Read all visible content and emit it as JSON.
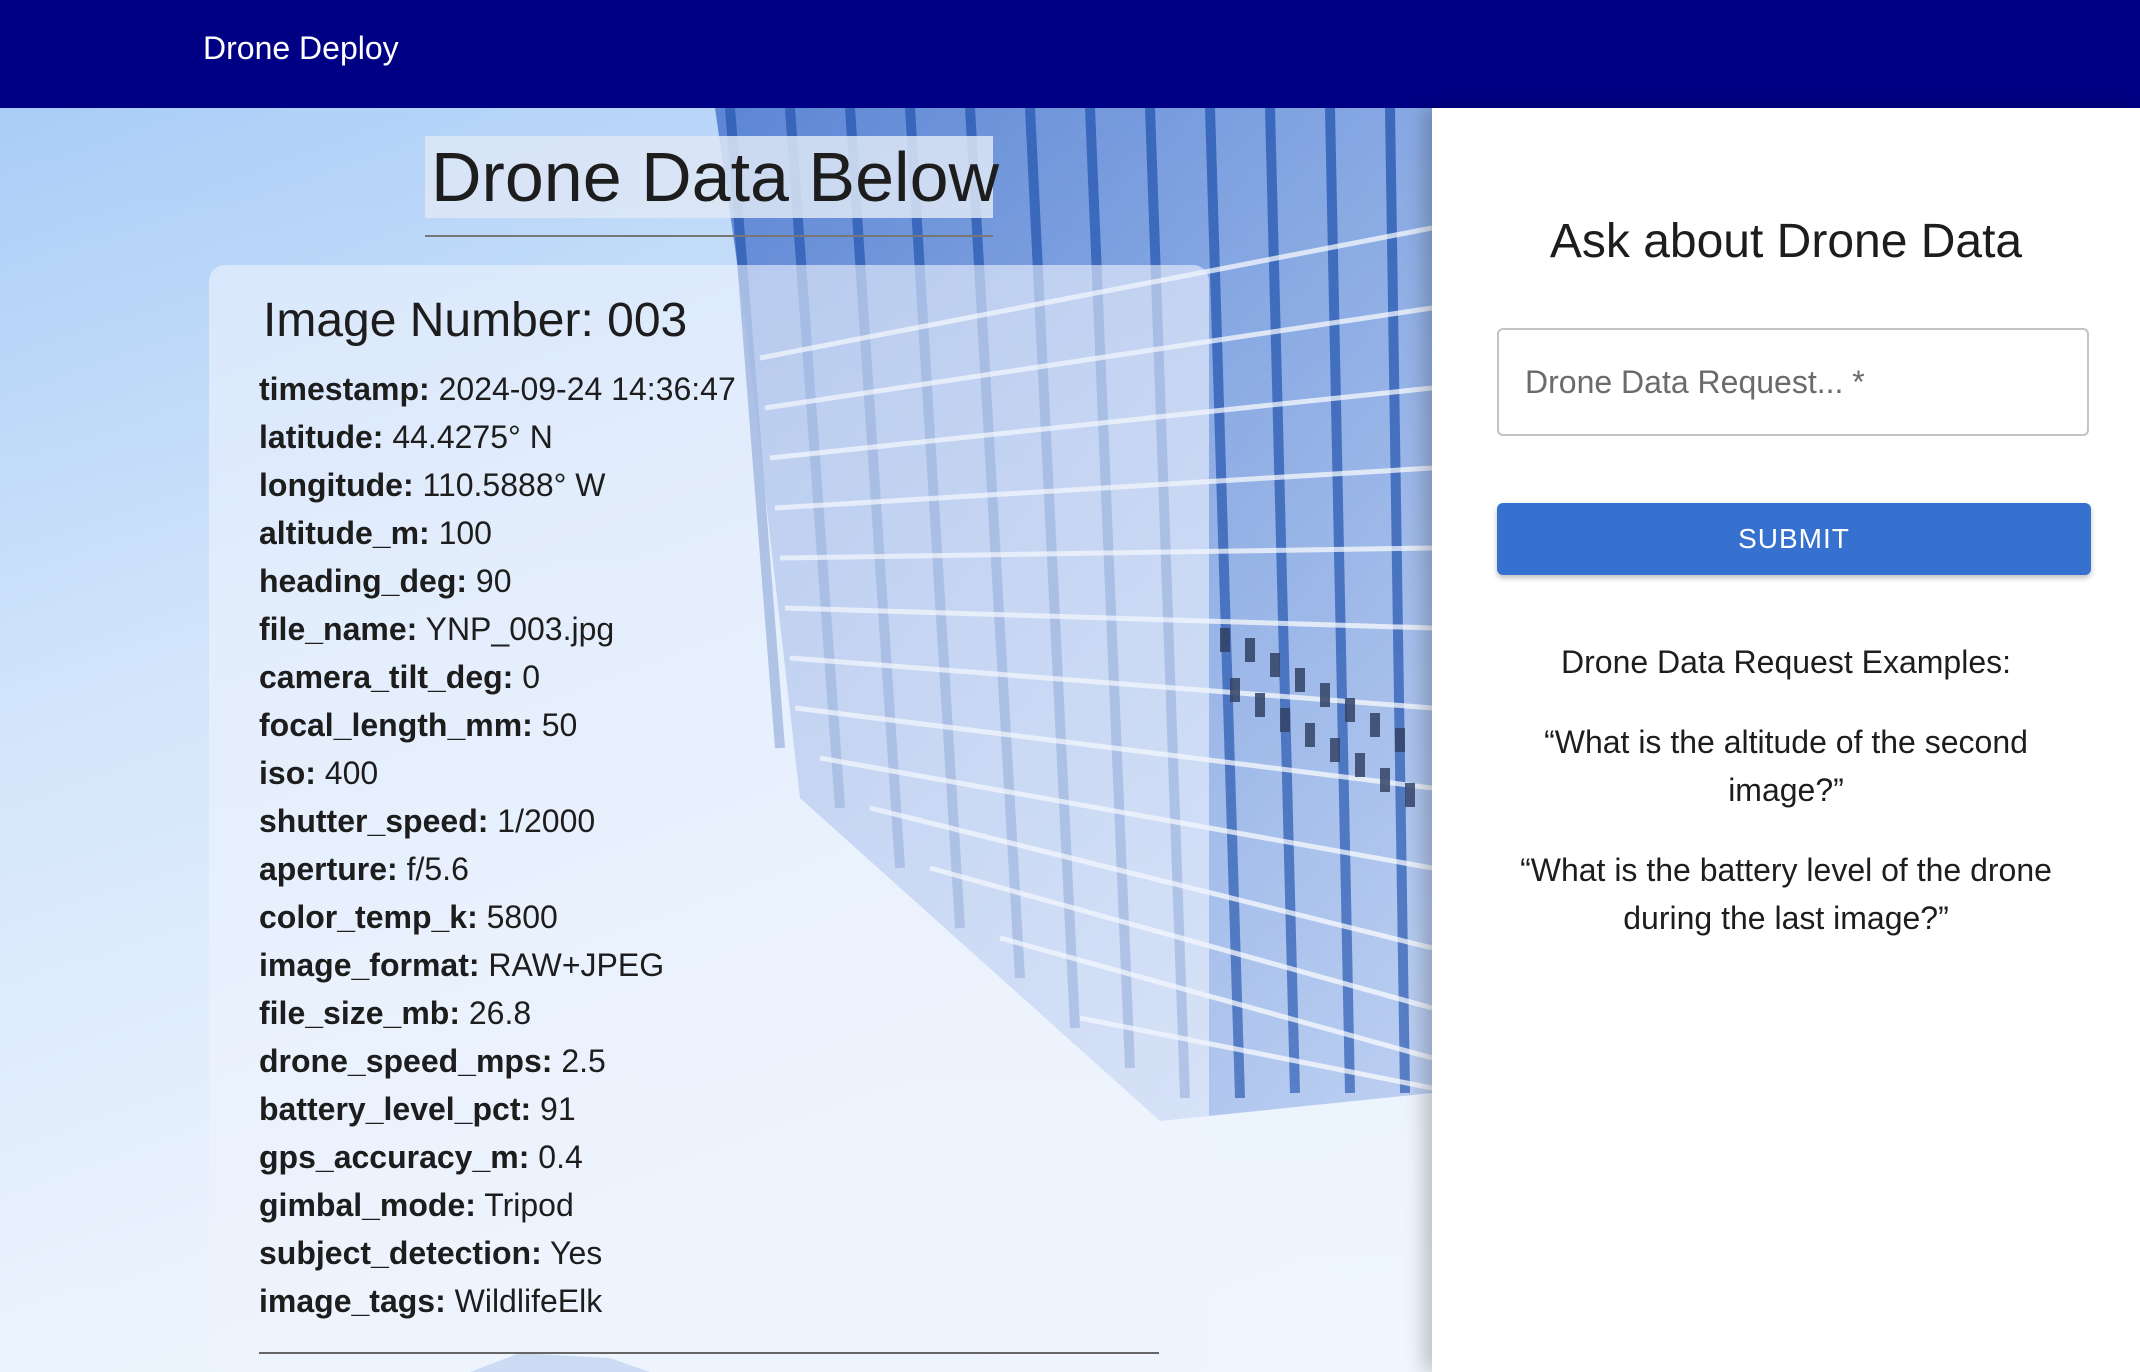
{
  "header": {
    "brand": "Drone Deploy",
    "background_color": "#000085"
  },
  "main": {
    "title": "Drone Data Below",
    "card": {
      "title": "Image Number: 003",
      "fields": [
        {
          "key": "timestamp:",
          "value": "2024-09-24 14:36:47"
        },
        {
          "key": "latitude:",
          "value": "44.4275° N"
        },
        {
          "key": "longitude:",
          "value": "110.5888° W"
        },
        {
          "key": "altitude_m:",
          "value": "100"
        },
        {
          "key": "heading_deg:",
          "value": "90"
        },
        {
          "key": "file_name:",
          "value": "YNP_003.jpg"
        },
        {
          "key": "camera_tilt_deg:",
          "value": "0"
        },
        {
          "key": "focal_length_mm:",
          "value": "50"
        },
        {
          "key": "iso:",
          "value": "400"
        },
        {
          "key": "shutter_speed:",
          "value": "1/2000"
        },
        {
          "key": "aperture:",
          "value": "f/5.6"
        },
        {
          "key": "color_temp_k:",
          "value": "5800"
        },
        {
          "key": "image_format:",
          "value": "RAW+JPEG"
        },
        {
          "key": "file_size_mb:",
          "value": "26.8"
        },
        {
          "key": "drone_speed_mps:",
          "value": "2.5"
        },
        {
          "key": "battery_level_pct:",
          "value": "91"
        },
        {
          "key": "gps_accuracy_m:",
          "value": "0.4"
        },
        {
          "key": "gimbal_mode:",
          "value": "Tripod"
        },
        {
          "key": "subject_detection:",
          "value": "Yes"
        },
        {
          "key": "image_tags:",
          "value": "WildlifeElk"
        }
      ]
    }
  },
  "sidebar": {
    "title": "Ask about Drone Data",
    "request_placeholder": "Drone Data Request... *",
    "request_value": "",
    "submit_label": "SUBMIT",
    "submit_color": "#3671cf",
    "examples_heading": "Drone Data Request Examples:",
    "examples": [
      "“What is the altitude of the second image?”",
      "“What is the battery level of the drone during the last image?”"
    ]
  }
}
